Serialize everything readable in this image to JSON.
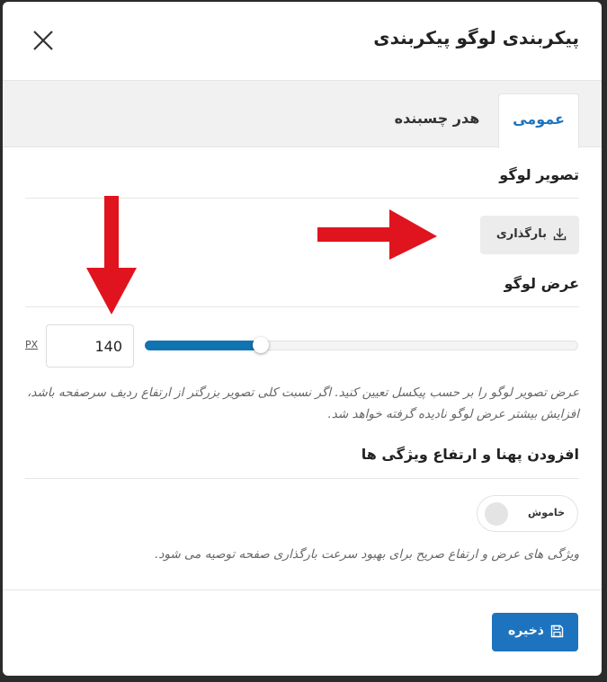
{
  "dialog": {
    "title": "پیکربندی لوگو پیکربندی"
  },
  "tabs": [
    {
      "label": "عمومی",
      "active": true
    },
    {
      "label": "هدر چسبنده",
      "active": false
    }
  ],
  "logo_image": {
    "title": "تصویر لوگو",
    "upload_label": "بارگذاری",
    "upload_icon": "download-icon"
  },
  "logo_width": {
    "title": "عرض لوگو",
    "value": "140",
    "unit": "PX",
    "slider_fraction": 0.27,
    "help": "عرض تصویر لوگو را بر حسب پیکسل تعیین کنید. اگر نسبت کلی تصویر بزرگتر از ارتفاع ردیف سرصفحه باشد، افزایش بیشتر عرض لوگو نادیده گرفته خواهد شد."
  },
  "dimension_attrs": {
    "title": "افزودن پهنا و ارتفاع ویژگی ها",
    "toggle_label": "خاموش",
    "toggle_on": false,
    "help": "ویژگی های عرض و ارتفاع صریح برای بهبود سرعت بارگذاری صفحه توصیه می شود."
  },
  "footer": {
    "save_label": "ذخیره",
    "save_icon": "floppy-disk-icon"
  },
  "colors": {
    "accent": "#1e73be",
    "annotation_arrow": "#e0141e"
  }
}
